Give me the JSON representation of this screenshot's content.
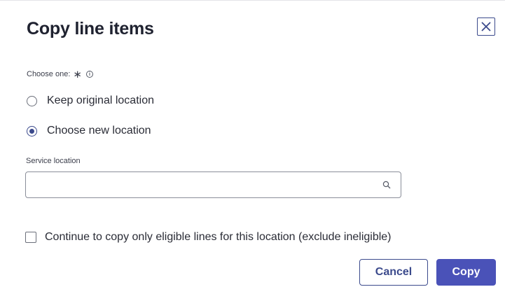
{
  "dialog": {
    "title": "Copy line items",
    "close_icon": "close-x-icon"
  },
  "choice": {
    "label": "Choose one:",
    "required_mark": "∗",
    "info_icon": "info-icon",
    "options": [
      {
        "label": "Keep original location",
        "selected": false
      },
      {
        "label": "Choose new location",
        "selected": true
      }
    ]
  },
  "service_location": {
    "label": "Service location",
    "value": "",
    "placeholder": "",
    "icon": "search-icon"
  },
  "eligibility_checkbox": {
    "label": "Continue to copy only eligible lines for this location (exclude ineligible)",
    "checked": false
  },
  "footer": {
    "cancel_label": "Cancel",
    "copy_label": "Copy"
  },
  "colors": {
    "accent": "#3b4a8c",
    "primary_button": "#4a52b8"
  }
}
